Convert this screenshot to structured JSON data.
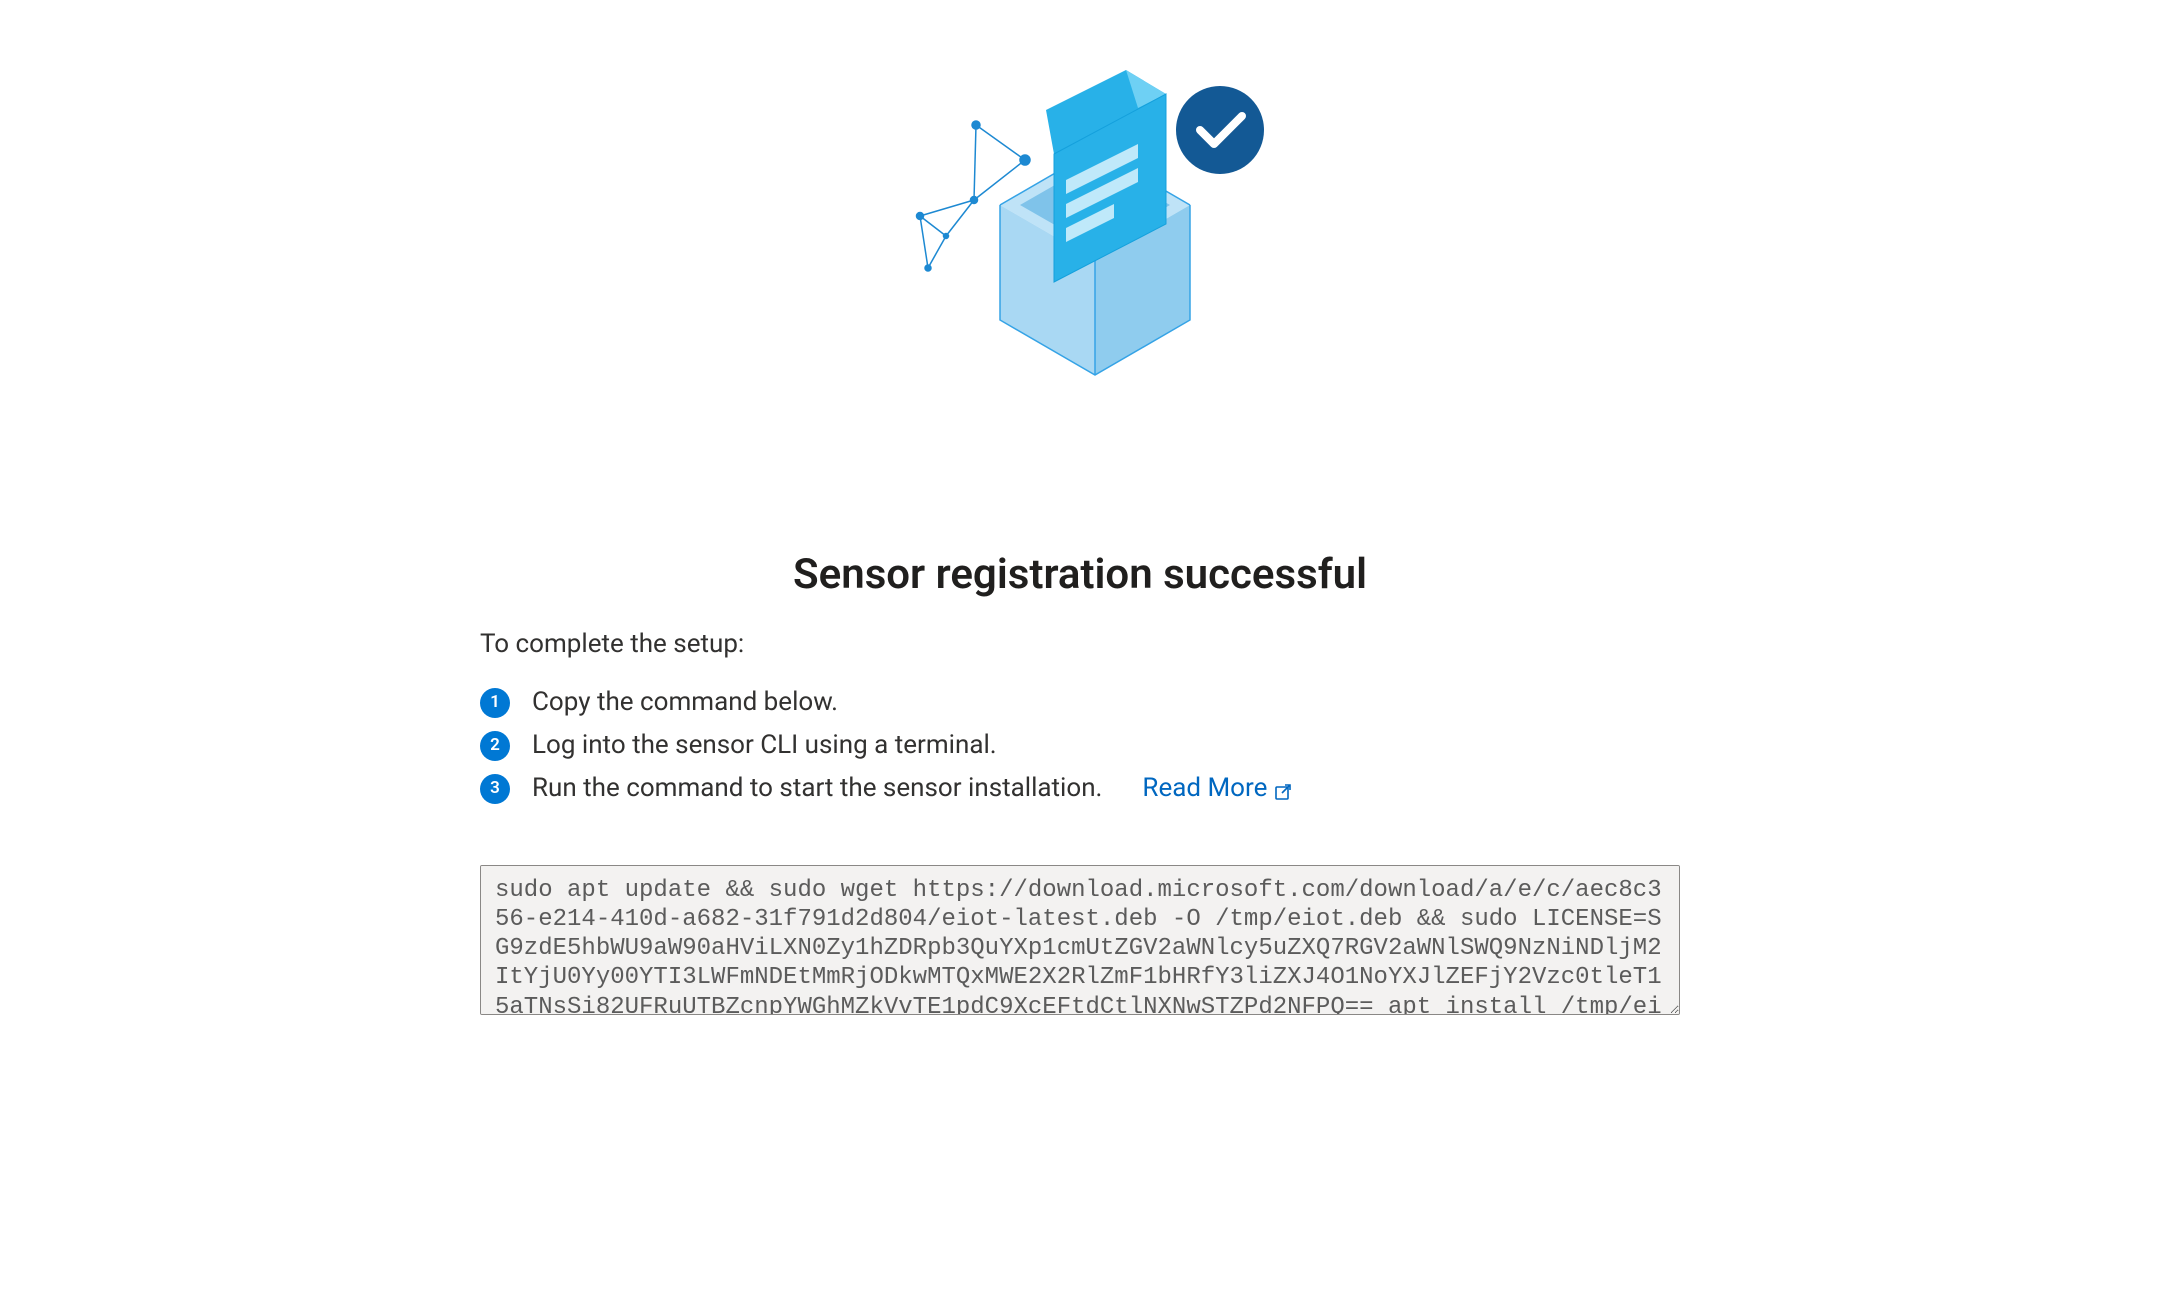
{
  "hero": {
    "alt": "registration-success-illustration"
  },
  "title": "Sensor registration successful",
  "intro": "To complete the setup:",
  "steps": [
    "Copy the command below.",
    "Log into the sensor CLI using a terminal.",
    "Run the command to start the sensor installation."
  ],
  "read_more_label": "Read More",
  "command": "sudo apt update && sudo wget https://download.microsoft.com/download/a/e/c/aec8c356-e214-410d-a682-31f791d2d804/eiot-latest.deb -O /tmp/eiot.deb && sudo LICENSE=SG9zdE5hbWU9aW90aHViLXN0Zy1hZDRpb3QuYXp1cmUtZGV2aWNlcy5uZXQ7RGV2aWNlSWQ9NzNiNDljM2ItYjU0Yy00YTI3LWFmNDEtMmRjODkwMTQxMWE2X2RlZmF1bHRfY3liZXJ4O1NoYXJlZEFjY2Vzc0tleT15aTNsSi82UFRuUTBZcnpYWGhMZkVvTE1pdC9XcEFtdCtlNXNwSTZPd2NFPQ== apt install /tmp/eiot.deb"
}
